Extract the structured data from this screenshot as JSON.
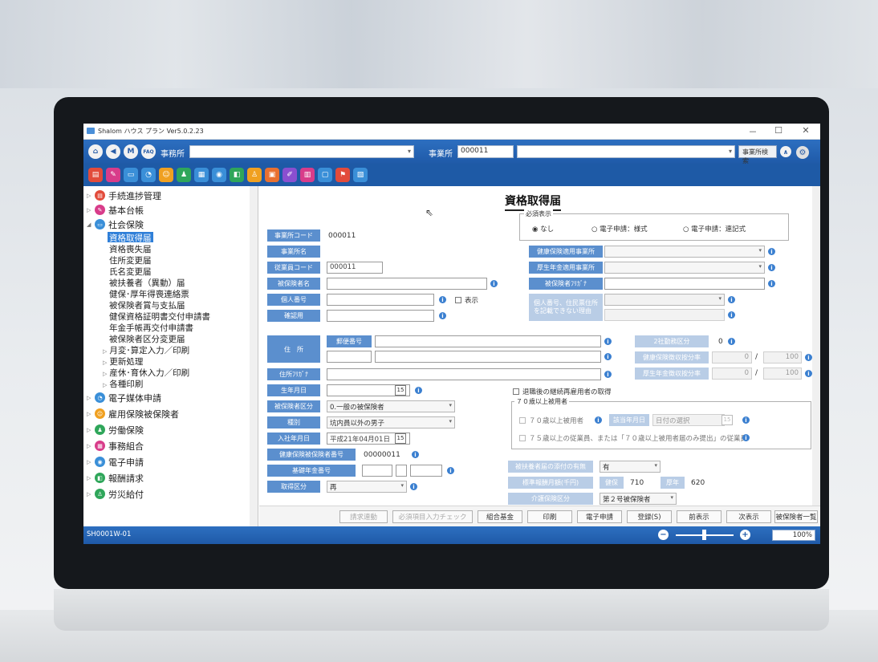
{
  "window": {
    "title": "Shalom ハウス プラン Ver5.0.2.23",
    "controls": [
      "－",
      "☐",
      "✕"
    ]
  },
  "toolbar": {
    "office_label": "事務所",
    "office_value": "",
    "jigyosho_label": "事業所",
    "jigyosho_code": "000011",
    "jigyosho_name": "",
    "search_button": "事業所検索",
    "nav_icons": [
      "home-icon",
      "back-icon",
      "manual-icon",
      "faq-icon"
    ],
    "faq_label": "FAQ",
    "manual_label": "M"
  },
  "toolbar2_icons": [
    {
      "name": "tool-icon-1",
      "color": "#e24b3b"
    },
    {
      "name": "tool-icon-2",
      "color": "#d83c8a"
    },
    {
      "name": "tool-icon-3",
      "color": "#3a8fd8"
    },
    {
      "name": "tool-icon-4",
      "color": "#3a8fd8"
    },
    {
      "name": "tool-icon-5",
      "color": "#f0a020"
    },
    {
      "name": "tool-icon-6",
      "color": "#2fa65a"
    },
    {
      "name": "tool-icon-7",
      "color": "#3a8fd8"
    },
    {
      "name": "tool-icon-8",
      "color": "#3a8fd8"
    },
    {
      "name": "tool-icon-9",
      "color": "#2fa65a"
    },
    {
      "name": "tool-icon-10",
      "color": "#f0a020"
    },
    {
      "name": "tool-icon-11",
      "color": "#e87030"
    },
    {
      "name": "tool-icon-12",
      "color": "#8a4fd0"
    },
    {
      "name": "tool-icon-13",
      "color": "#d83c8a"
    },
    {
      "name": "tool-icon-14",
      "color": "#3a8fd8"
    },
    {
      "name": "tool-icon-15",
      "color": "#e24b3b"
    },
    {
      "name": "tool-icon-16",
      "color": "#3a8fd8"
    }
  ],
  "sidebar": {
    "top_nodes": [
      {
        "label": "手続進捗管理",
        "color": "#e24b3b"
      },
      {
        "label": "基本台帳",
        "color": "#d83c8a"
      },
      {
        "label": "社会保険",
        "color": "#3a8fd8"
      }
    ],
    "social_children": [
      "資格取得届",
      "資格喪失届",
      "住所変更届",
      "氏名変更届",
      "被扶養者（異動）届",
      "健保･厚年得喪連絡票",
      "被保険者賞与支払届",
      "健保資格証明書交付申請書",
      "年金手帳再交付申請書",
      "被保険者区分変更届"
    ],
    "social_groups": [
      "月変･算定入力／印刷",
      "更新処理",
      "産休･育休入力／印刷",
      "各種印刷"
    ],
    "bottom_nodes": [
      {
        "label": "電子媒体申請",
        "color": "#3a8fd8"
      },
      {
        "label": "雇用保険被保険者",
        "color": "#f0a020"
      },
      {
        "label": "労働保険",
        "color": "#2fa65a"
      },
      {
        "label": "事務組合",
        "color": "#d83c8a"
      },
      {
        "label": "電子申請",
        "color": "#3a8fd8"
      },
      {
        "label": "報酬請求",
        "color": "#2fa65a"
      },
      {
        "label": "労災給付",
        "color": "#2fa65a"
      }
    ]
  },
  "form": {
    "title": "資格取得届",
    "required_display": {
      "legend": "必須表示",
      "options": [
        "なし",
        "電子申請：様式",
        "電子申請：連記式"
      ]
    },
    "labels": {
      "office_code": "事業所コード",
      "office_name": "事業所名",
      "employee_code": "従業員コード",
      "insured_name": "被保険者名",
      "my_number": "個人番号",
      "confirm": "確認用",
      "address": "住　所",
      "postal": "郵便番号",
      "address_kana": "住所ﾌﾘｶﾞﾅ",
      "birthdate": "生年月日",
      "insured_class": "被保険者区分",
      "type": "種別",
      "join_date": "入社年月日",
      "health_no": "健康保険被保険者番号",
      "pension_no": "基礎年金番号",
      "acq_class": "取得区分",
      "health_office": "健康保険適用事業所",
      "pension_office": "厚生年金適用事業所",
      "insured_kana": "被保険者ﾌﾘｶﾞﾅ",
      "no_my_number": "個人番号、住民票住所\nを記載できない理由",
      "two_office": "2社勤務区分",
      "health_rate": "健康保険徴収按分率",
      "pension_rate": "厚生年金徴収按分率",
      "dependents": "被扶養者届の添付の有無",
      "standard_pay": "標準報酬月額(千円)",
      "care_class": "介護保険区分",
      "applicable_date": "該当年月日"
    },
    "values": {
      "office_code": "000011",
      "employee_code": "000011",
      "show": "表示",
      "insured_class": "0.一般の被保険者",
      "type": "坑内員以外の男子",
      "join_date": "平成21年04月01日",
      "health_no": "00000011",
      "acq_class": "再",
      "two_office": "0",
      "health_rate_num": "0",
      "health_rate_den": "100",
      "pension_rate_num": "0",
      "pension_rate_den": "100",
      "retire_rehire": "退職後の継続再雇用者の取得",
      "over70_legend": "７０歳以上被用者",
      "over70_check": "７０歳以上被用者",
      "applicable_date_placeholder": "日付の選択",
      "over75_check": "７５歳以上の従業員、または「７０歳以上被用者届のみ提出」の従業員",
      "dependents": "有",
      "health_label": "健保",
      "health_amount": "710",
      "pension_label": "厚年",
      "pension_amount": "620",
      "care_class": "第２号被保険者",
      "calendar_day": "15"
    }
  },
  "buttons": [
    {
      "label": "請求連動",
      "disabled": true
    },
    {
      "label": "必須項目入力チェック",
      "disabled": true
    },
    {
      "label": "組合基金",
      "disabled": false
    },
    {
      "label": "印刷",
      "disabled": false
    },
    {
      "label": "電子申請",
      "disabled": false
    },
    {
      "label": "登録(S)",
      "disabled": false
    },
    {
      "label": "前表示",
      "disabled": false
    },
    {
      "label": "次表示",
      "disabled": false
    },
    {
      "label": "被保険者一覧",
      "disabled": false
    }
  ],
  "status": {
    "screen_code": "SH0001W-01",
    "zoom": "100%",
    "zoom_level": 0.5
  }
}
